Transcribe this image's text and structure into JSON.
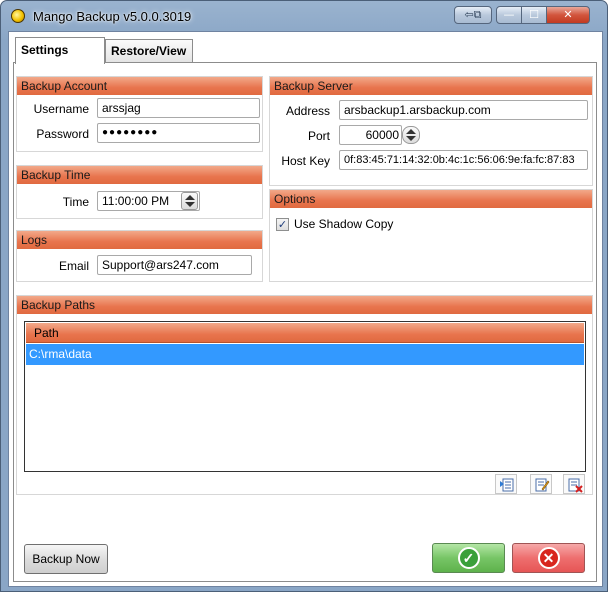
{
  "window": {
    "title": "Mango Backup v5.0.0.3019",
    "controls": {
      "restore_glyph": "⇦⧉",
      "minimize_glyph": "—",
      "maximize_glyph": "☐",
      "close_glyph": "✕"
    }
  },
  "tabs": [
    {
      "label": "Settings",
      "active": true
    },
    {
      "label": "Restore/View",
      "active": false
    }
  ],
  "backup_account": {
    "header": "Backup Account",
    "username_label": "Username",
    "username_value": "arssjag",
    "password_label": "Password",
    "password_value": "●●●●●●●●"
  },
  "backup_time": {
    "header": "Backup Time",
    "time_label": "Time",
    "time_value": "11:00:00 PM"
  },
  "logs": {
    "header": "Logs",
    "email_label": "Email",
    "email_value": "Support@ars247.com"
  },
  "backup_server": {
    "header": "Backup Server",
    "address_label": "Address",
    "address_value": "arsbackup1.arsbackup.com",
    "port_label": "Port",
    "port_value": "60000",
    "hostkey_label": "Host Key",
    "hostkey_value": "0f:83:45:71:14:32:0b:4c:1c:56:06:9e:fa:fc:87:83"
  },
  "options": {
    "header": "Options",
    "shadow_copy_label": "Use Shadow Copy",
    "shadow_copy_checked": true,
    "check_glyph": "✓"
  },
  "backup_paths": {
    "header": "Backup Paths",
    "columns": [
      "Path"
    ],
    "rows": [
      "C:\\rma\\data"
    ],
    "toolbar_icons": [
      "add-path-icon",
      "edit-path-icon",
      "delete-path-icon"
    ]
  },
  "footer": {
    "backup_now_label": "Backup Now",
    "ok_glyph": "✓",
    "cancel_glyph": "✕"
  },
  "colors": {
    "header_accent": "#e8744d",
    "selection": "#3399ff",
    "ok_green": "#77c566",
    "cancel_red": "#ee6f6f"
  }
}
